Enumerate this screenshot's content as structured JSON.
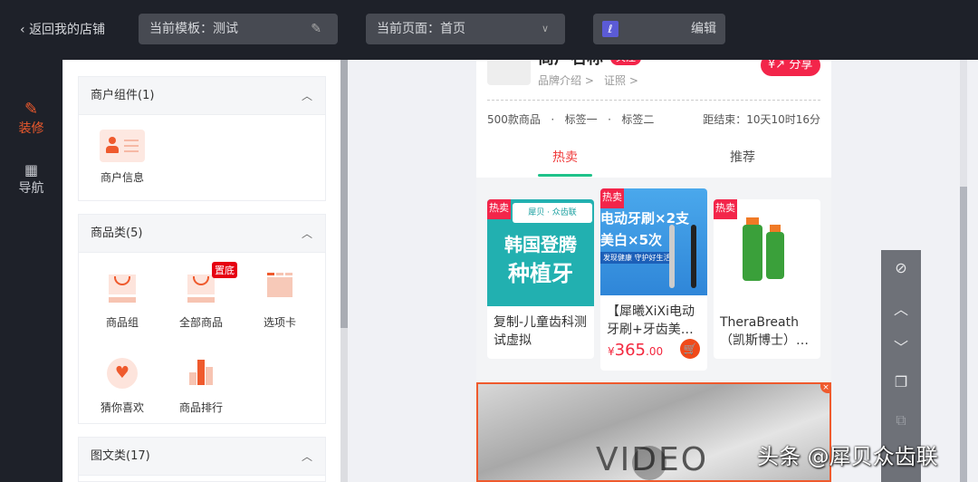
{
  "topbar": {
    "back_label": "返回我的店铺",
    "template_label": "当前模板：测试",
    "page_label": "当前页面：首页",
    "edit_label": "编辑"
  },
  "leftnav": {
    "items": [
      {
        "label": "装修",
        "active": true
      },
      {
        "label": "导航",
        "active": false
      }
    ]
  },
  "panel": {
    "sections": [
      {
        "title": "商户组件(1)",
        "items": [
          {
            "label": "商户信息"
          }
        ]
      },
      {
        "title": "商品类(5)",
        "items": [
          {
            "label": "商品组"
          },
          {
            "label": "全部商品",
            "badge": "置底"
          },
          {
            "label": "选项卡"
          },
          {
            "label": "猜你喜欢"
          },
          {
            "label": "商品排行"
          }
        ]
      },
      {
        "title": "图文类(17)"
      }
    ]
  },
  "phone": {
    "store_name": "商户名称",
    "store_tag": "关注",
    "share_label": "分享",
    "links": [
      "品牌介绍 >",
      "证照 >"
    ],
    "stats": {
      "count": "500款商品",
      "tag1": "标签一",
      "tag2": "标签二",
      "dot": "·",
      "countdown": "距结束：10天10时16分"
    },
    "tabs": [
      {
        "label": "热卖",
        "active": true
      },
      {
        "label": "推荐",
        "active": false
      }
    ],
    "products": [
      {
        "badge": "热卖",
        "img_brand": "犀贝 · 众齿联",
        "img_line1": "韩国登腾",
        "img_line2": "种植牙",
        "title": "复制-儿童齿科测试虚拟"
      },
      {
        "badge": "热卖",
        "img_line1": "电动牙刷×2支",
        "img_line2": "美白×5次",
        "img_line3": "发现健康 守护好生活",
        "title": "【犀曦XiXi电动牙刷+牙齿美…",
        "price_symbol": "¥",
        "price_int": "365",
        "price_dec": ".00"
      },
      {
        "badge": "热卖",
        "title": "TheraBreath（凯斯博士）…"
      }
    ],
    "video_label": "VIDEO"
  },
  "watermark": "头条 @犀贝众齿联",
  "colors": {
    "accent": "#ef5a2d",
    "topbar": "#1e2129",
    "tab_underline": "#1fc28a",
    "price": "#f3273e"
  }
}
